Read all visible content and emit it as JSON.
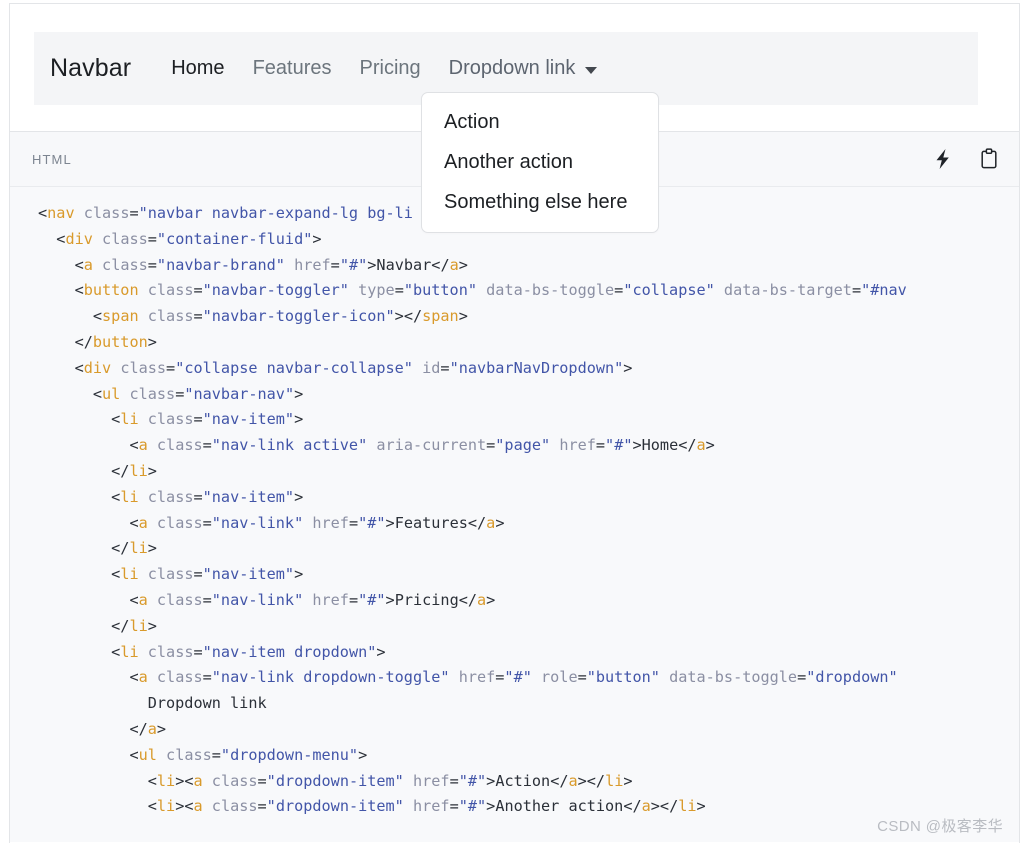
{
  "preview": {
    "navbar": {
      "brand": "Navbar",
      "links": [
        {
          "label": "Home",
          "active": true
        },
        {
          "label": "Features",
          "active": false
        },
        {
          "label": "Pricing",
          "active": false
        }
      ],
      "dropdown": {
        "label": "Dropdown link",
        "caret_icon": "chevron-down-icon",
        "open": true,
        "items": [
          "Action",
          "Another action",
          "Something else here"
        ]
      }
    }
  },
  "code_panel": {
    "language_label": "HTML",
    "actions": [
      {
        "name": "run",
        "icon": "lightning-bolt-icon"
      },
      {
        "name": "copy",
        "icon": "clipboard-icon"
      }
    ],
    "lines": [
      "<nav class=\"navbar navbar-expand-lg bg-li",
      "  <div class=\"container-fluid\">",
      "    <a class=\"navbar-brand\" href=\"#\">Navbar</a>",
      "    <button class=\"navbar-toggler\" type=\"button\" data-bs-toggle=\"collapse\" data-bs-target=\"#nav",
      "      <span class=\"navbar-toggler-icon\"></span>",
      "    </button>",
      "    <div class=\"collapse navbar-collapse\" id=\"navbarNavDropdown\">",
      "      <ul class=\"navbar-nav\">",
      "        <li class=\"nav-item\">",
      "          <a class=\"nav-link active\" aria-current=\"page\" href=\"#\">Home</a>",
      "        </li>",
      "        <li class=\"nav-item\">",
      "          <a class=\"nav-link\" href=\"#\">Features</a>",
      "        </li>",
      "        <li class=\"nav-item\">",
      "          <a class=\"nav-link\" href=\"#\">Pricing</a>",
      "        </li>",
      "        <li class=\"nav-item dropdown\">",
      "          <a class=\"nav-link dropdown-toggle\" href=\"#\" role=\"button\" data-bs-toggle=\"dropdown\"",
      "            Dropdown link",
      "          </a>",
      "          <ul class=\"dropdown-menu\">",
      "            <li><a class=\"dropdown-item\" href=\"#\">Action</a></li>",
      "            <li><a class=\"dropdown-item\" href=\"#\">Another action</a></li>"
    ]
  },
  "watermark": "CSDN @极客李华",
  "colors": {
    "navbar_bg": "#f4f5f7",
    "code_bg": "#f8f9fb",
    "toolbar_bg": "#f7f8fa",
    "tag": "#d99a2b",
    "attr": "#8b8fa3",
    "value": "#4255a8",
    "text": "#1f2328",
    "muted": "#6c757d"
  }
}
